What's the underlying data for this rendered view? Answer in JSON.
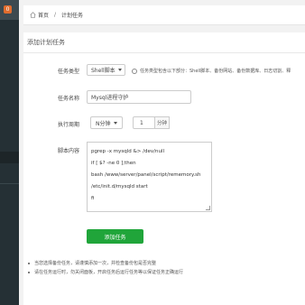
{
  "sidebar": {
    "badge": "0"
  },
  "breadcrumb": {
    "home": "首页",
    "separator": "/",
    "current": "计划任务"
  },
  "panel": {
    "title": "添加计划任务",
    "task_type": {
      "label": "任务类型",
      "value": "Shell脚本",
      "hint": "任务类型包含以下部分：Shell脚本、备份网站、备份数据库、日志切割、释"
    },
    "task_name": {
      "label": "任务名称",
      "value": "Mysql进程守护"
    },
    "period": {
      "label": "执行周期",
      "select": "N分钟",
      "value": "1",
      "unit": "分钟"
    },
    "script": {
      "label": "脚本内容",
      "lines": [
        "pgrep -x mysqld &> /dev/null",
        "if [ $? -ne 0 ];then",
        "bash /www/server/panel/script/rememory.sh",
        "/etc/init.d/mysqld start",
        "fi"
      ]
    },
    "submit_label": "添加任务",
    "notes": [
      "当您选择备份任务，请谨慎添加一次，并检查备份包是否完整",
      "请在任务运行时，勿关闭面板，开启任务后运行任务等以保证任务正确运行"
    ]
  }
}
